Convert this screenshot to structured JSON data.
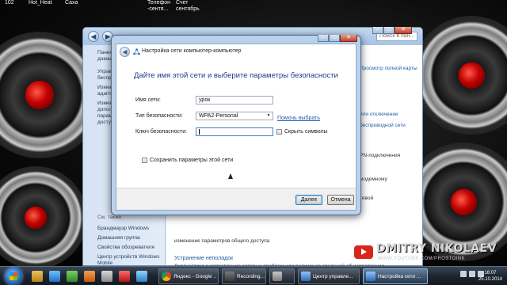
{
  "desktop": {
    "icons": [
      {
        "label": "102"
      },
      {
        "label": "Hot_Heat"
      },
      {
        "label": "Саха"
      },
      {
        "label": "Телефон\n-сентя..."
      },
      {
        "label": "Счет\nсентябрь"
      }
    ]
  },
  "explorer": {
    "search_placeholder": "Поиск в пан...",
    "sidebar": {
      "items": [
        "Панель управления - домашняя страница",
        "Управление беспроводными сетями",
        "Изменение параметров адаптера",
        "Изменить дополнительные параметры общего доступа"
      ],
      "see_also": "См. также",
      "see_also_items": [
        "Брандмауэр Windows",
        "Домашняя группа",
        "Свойства обозревателя",
        "Центр устройств Windows Mobile"
      ]
    },
    "main": {
      "right_links": [
        "Просмотр полной карты",
        "или отключение",
        "беспроводной сети",
        "PN-подключения",
        "модемному",
        "тевой"
      ],
      "troubleshoot_link": "Устранение неполадок",
      "troubleshoot_desc": "Диагностика и исправление сетевых проблем или получение сведений об исправлении.",
      "sharing_desc": "изменение параметров общего доступа"
    }
  },
  "dialog": {
    "title": "Настройка сети компьютер-компьютер",
    "heading": "Дайте имя этой сети и выберите параметры безопасности",
    "network_name_label": "Имя сети:",
    "network_name_value": "урок",
    "security_type_label": "Тип безопасности:",
    "security_type_value": "WPA2-Personal",
    "help_link": "Помочь выбрать",
    "security_key_label": "Ключ безопасности:",
    "security_key_value": "",
    "hide_chars_label": "Скрыть символы",
    "save_settings_label": "Сохранить параметры этой сети",
    "next_button": "Далее",
    "cancel_button": "Отмена"
  },
  "watermark": {
    "name": "DMITRY NIKOLAEV",
    "url": "WWW.YOUTUBE.COM/PROSTOINK"
  },
  "taskbar": {
    "tasks": [
      {
        "label": "Яндекс - Google ...",
        "active": false
      },
      {
        "label": "Recording...",
        "active": false
      },
      {
        "label": "",
        "active": false
      },
      {
        "label": "Центр управле...",
        "active": false
      },
      {
        "label": "Настройка сети ...",
        "active": true
      }
    ],
    "time": "16:07",
    "date": "25.10.2014"
  },
  "colors": {
    "dialog_heading": "#1e3a8a",
    "link": "#1f5ea8",
    "accent_red": "#c00000"
  }
}
